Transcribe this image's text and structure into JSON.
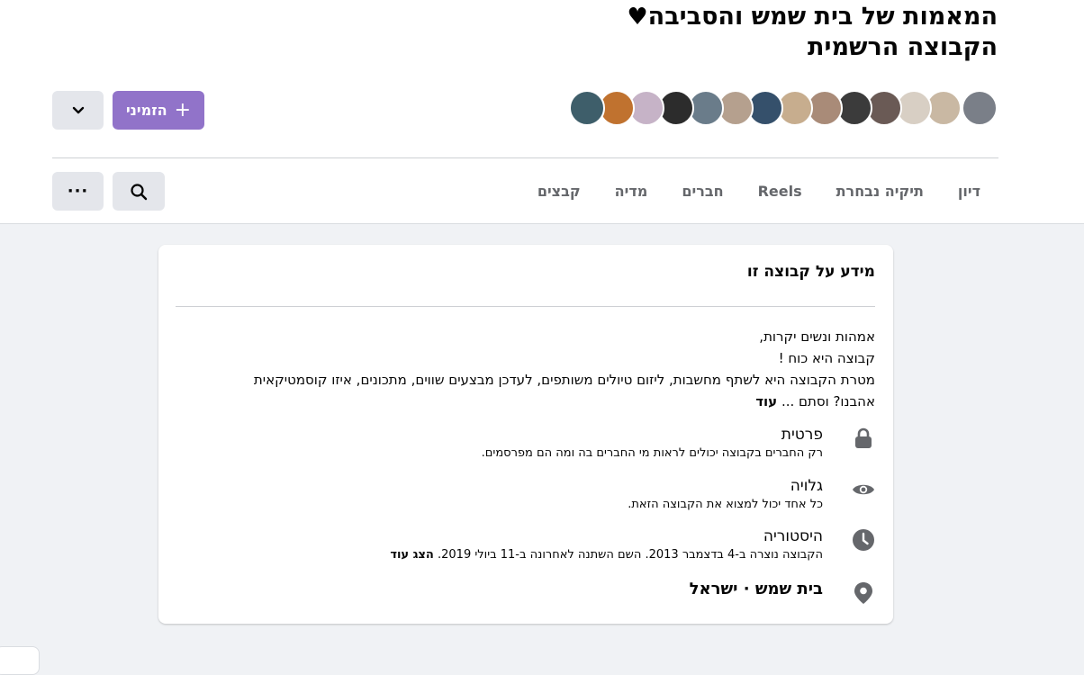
{
  "group": {
    "title_line1": "המאמות של בית שמש והסביבה",
    "title_line2": "הקבוצה הרשמית",
    "title_heart": "♥"
  },
  "avatars": [
    {
      "color": "#7a7f88"
    },
    {
      "color": "#c9b8a3"
    },
    {
      "color": "#d8cfc4"
    },
    {
      "color": "#6a5a55"
    },
    {
      "color": "#3b3b3b"
    },
    {
      "color": "#a98b78"
    },
    {
      "color": "#c7ad8e"
    },
    {
      "color": "#35506b"
    },
    {
      "color": "#b5a08e"
    },
    {
      "color": "#6a7c8a"
    },
    {
      "color": "#2c2c2c"
    },
    {
      "color": "#c6b3c7"
    },
    {
      "color": "#c0722f"
    },
    {
      "color": "#3e5e6a"
    }
  ],
  "actions": {
    "invite_label": "הזמיני",
    "invite_icon": "plus-icon",
    "dropdown_icon": "chevron-down-icon",
    "search_icon": "search-icon",
    "more_label": "···"
  },
  "tabs": [
    "דיון",
    "תיקיה נבחרת",
    "Reels",
    "חברים",
    "מדיה",
    "קבצים"
  ],
  "about": {
    "title": "מידע על קבוצה זו",
    "description_lines": [
      "אמהות ונשים יקרות,",
      "קבוצה היא כוח !",
      "מטרת הקבוצה היא לשתף מחשבות, ליזום טיולים משותפים, לעדכן מבצעים שווים, מתכונים, איזו קוסמטיקאית",
      "אהבנו? וסתם ..."
    ],
    "see_more": "עוד",
    "privacy": {
      "icon": "lock-icon",
      "title": "פרטית",
      "subtitle": "רק החברים בקבוצה יכולים לראות מי החברים בה ומה הם מפרסמים."
    },
    "visibility": {
      "icon": "eye-icon",
      "title": "גלויה",
      "subtitle": "כל אחד יכול למצוא את הקבוצה הזאת."
    },
    "history": {
      "icon": "clock-icon",
      "title": "היסטוריה",
      "subtitle": "הקבוצה נוצרה ב-4 בדצמבר 2013. השם השתנה לאחרונה ב-11 ביולי 2019.",
      "show_more": "הצג עוד"
    },
    "location": {
      "icon": "location-pin-icon",
      "text": "בית שמש · ישראל"
    }
  },
  "colors": {
    "accent": "#9173c9",
    "icon_gray": "#65676b"
  }
}
